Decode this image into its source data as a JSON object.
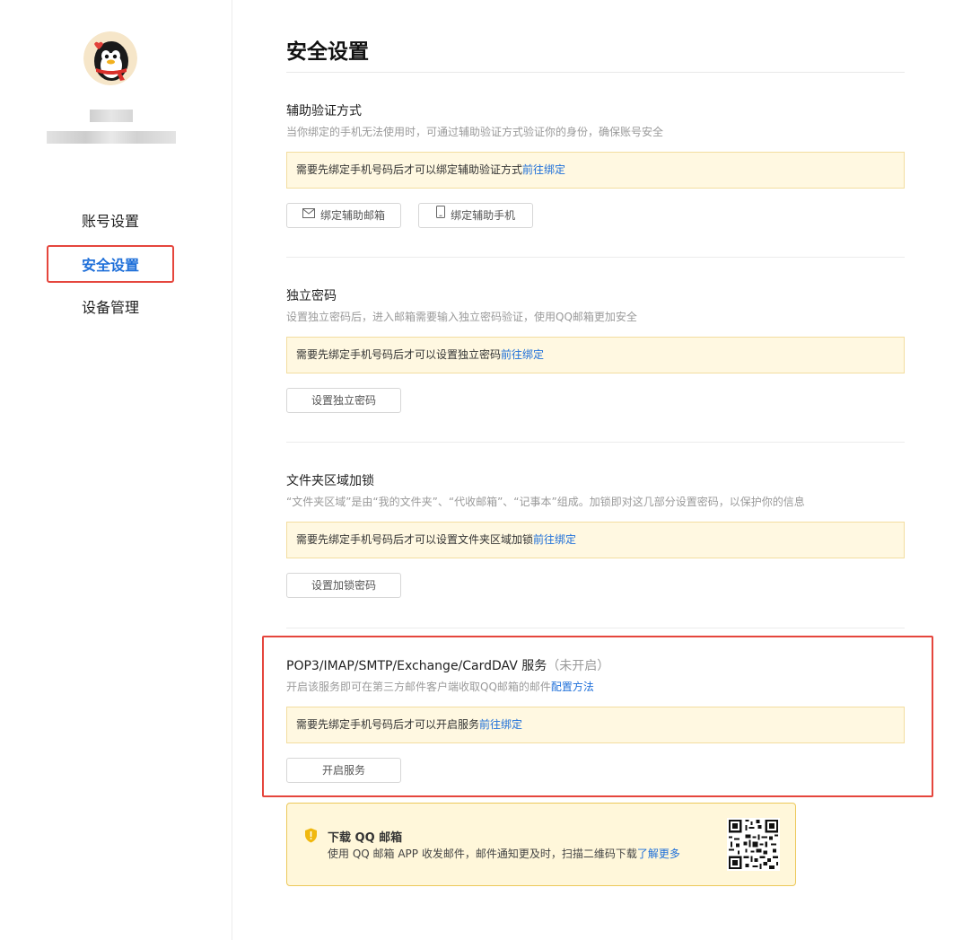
{
  "sidebar": {
    "avatar_icon": "penguin-avatar-icon",
    "nav": [
      {
        "label": "账号设置",
        "active": false
      },
      {
        "label": "安全设置",
        "active": true
      },
      {
        "label": "设备管理",
        "active": false
      }
    ]
  },
  "page": {
    "title": "安全设置"
  },
  "sections": {
    "aux_verify": {
      "title": "辅助验证方式",
      "desc": "当你绑定的手机无法使用时，可通过辅助验证方式验证你的身份，确保账号安全",
      "notice": "需要先绑定手机号码后才可以绑定辅助验证方式",
      "notice_link": "前往绑定",
      "btn_email": "绑定辅助邮箱",
      "btn_phone": "绑定辅助手机"
    },
    "independent_pwd": {
      "title": "独立密码",
      "desc": "设置独立密码后，进入邮箱需要输入独立密码验证，使用QQ邮箱更加安全",
      "notice": "需要先绑定手机号码后才可以设置独立密码",
      "notice_link": "前往绑定",
      "btn": "设置独立密码"
    },
    "folder_lock": {
      "title": "文件夹区域加锁",
      "desc": "“文件夹区域”是由“我的文件夹”、“代收邮箱”、“记事本”组成。加锁即对这几部分设置密码，以保护你的信息",
      "notice": "需要先绑定手机号码后才可以设置文件夹区域加锁",
      "notice_link": "前往绑定",
      "btn": "设置加锁密码"
    },
    "pop3": {
      "title": "POP3/IMAP/SMTP/Exchange/CardDAV 服务",
      "status": "（未开启）",
      "desc": "开启该服务即可在第三方邮件客户端收取QQ邮箱的邮件",
      "desc_link": "配置方法",
      "notice": "需要先绑定手机号码后才可以开启服务",
      "notice_link": "前往绑定",
      "btn": "开启服务"
    }
  },
  "download": {
    "title": "下载 QQ 邮箱",
    "desc": "使用 QQ 邮箱 APP 收发邮件，邮件通知更及时，扫描二维码下载",
    "link": "了解更多",
    "icon": "shield-icon"
  },
  "colors": {
    "accent": "#1e6fd9",
    "highlight": "#e5463d",
    "notice_bg": "#fff8e1"
  }
}
